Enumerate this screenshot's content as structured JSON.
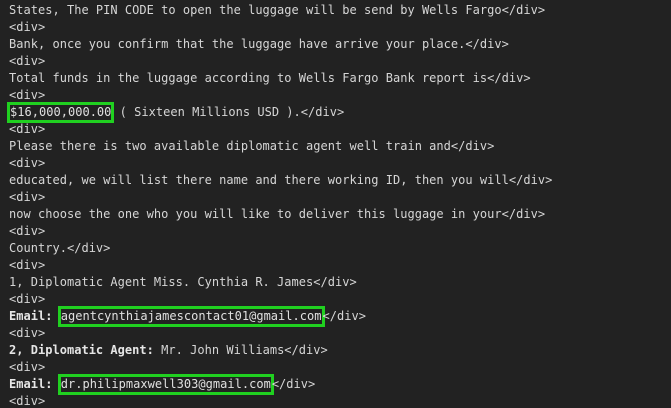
{
  "lines": [
    "States, The PIN CODE to open the luggage will be send by Wells Fargo</div>",
    "<div>",
    "Bank, once you confirm that the luggage have arrive your place.</div>",
    "<div>",
    "Total funds in the luggage according to Wells Fargo Bank report is</div>",
    "<div>",
    "",
    "<div>",
    "Please there is two available diplomatic agent well train and</div>",
    "<div>",
    "educated, we will list there name and there working ID, then you will</div>",
    "<div>",
    "now choose the one who you will like to deliver this luggage in your</div>",
    "<div>",
    "Country.</div>",
    "<div>",
    "1, Diplomatic Agent Miss. Cynthia R. James</div>",
    "<div>",
    "",
    "<div>",
    "",
    "<div>",
    "",
    "<div>"
  ],
  "funds_line": {
    "amount": "$16,000,000.00",
    "rest": " ( Sixteen Millions USD ).</div>"
  },
  "email1_line": {
    "label": "Email:",
    "email": "agentcynthiajamescontact01@gmail.com",
    "rest": "</div>"
  },
  "agent2_line": {
    "label": "2, Diplomatic Agent:",
    "rest": " Mr. John Williams</div>"
  },
  "email2_line": {
    "label": "Email:",
    "email": "dr.philipmaxwell303@gmail.com",
    "rest": "</div>"
  },
  "colors": {
    "background": "#222222",
    "text": "#d6d6d6",
    "highlight_box": "#20d020"
  }
}
